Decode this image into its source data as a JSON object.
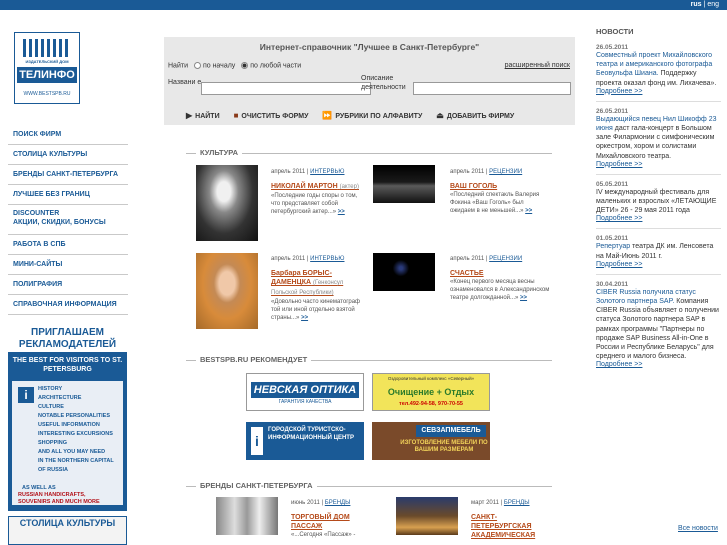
{
  "topbar": {
    "lang_active": "rus",
    "lang_sep": "|",
    "lang_other": "eng"
  },
  "logo": {
    "line1": "ИЗДАТЕЛЬСКИЙ ДОМ",
    "line2": "ТЕЛИНФО",
    "line3": "WWW.BESTSPB.RU"
  },
  "leftnav": {
    "items": [
      "ПОИСК ФИРМ",
      "СТОЛИЦА КУЛЬТУРЫ",
      "БРЕНДЫ САНКТ-ПЕТЕРБУРГА",
      "ЛУЧШЕЕ БЕЗ ГРАНИЦ",
      "DISCOUNTER",
      "РАБОТА В СПБ",
      "МИНИ-САЙТЫ",
      "ПОЛИГРАФИЯ",
      "СПРАВОЧНАЯ ИНФОРМАЦИЯ"
    ],
    "discounter_sub": "АКЦИИ, СКИДКИ, БОНУСЫ"
  },
  "ad_left": {
    "heading": "ПРИГЛАШАЕМ РЕКЛАМОДАТЕЛЕЙ",
    "sub": "THE BEST FOR VISITORS TO ST. PETERSBURG",
    "list": [
      "HISTORY",
      "ARCHITECTURE",
      "CULTURE",
      "NOTABLE PERSONALITIES",
      "USEFUL INFORMATION",
      "INTERESTING EXCURSIONS",
      "SHOPPING",
      "AND ALL YOU MAY NEED",
      "IN THE NORTHERN CAPITAL",
      "OF RUSSIA"
    ],
    "as_well": "AS WELL AS",
    "red": [
      "RUSSIAN HANDICRAFTS,",
      "SOUVENIRS AND MUCH MORE"
    ]
  },
  "ad_left2": {
    "title": "СТОЛИЦА КУЛЬТУРЫ"
  },
  "search": {
    "title": "Интернет-справочник \"Лучшее в Санкт-Петербурге\"",
    "find_label": "Найти",
    "opt1": "по началу",
    "opt2": "по любой части",
    "advanced": "расширенный поиск",
    "name_label": "Названи е",
    "desc_label": "Описание деятельности",
    "btn_find": "НАЙТИ",
    "btn_clear": "ОЧИСТИТЬ ФОРМУ",
    "btn_rubrics": "РУБРИКИ ПО АЛФАВИТУ",
    "btn_add": "ДОБАВИТЬ ФИРМУ"
  },
  "sections": {
    "culture": "КУЛЬТУРА",
    "recommends": "BESTSPB.RU РЕКОМЕНДУЕТ",
    "brands": "БРЕНДЫ САНКТ-ПЕТЕРБУРГА"
  },
  "cards": [
    {
      "date": "апрель 2011 |",
      "tag": "ИНТЕРВЬЮ",
      "name": "НИКОЛАЙ МАРТОН",
      "extra": "(актер)",
      "text": "«Последние годы споры о том, что представляет собой петербургский актер...»",
      "more": ">>"
    },
    {
      "date": "апрель 2011 |",
      "tag": "РЕЦЕНЗИИ",
      "name": "ВАШ ГОГОЛЬ",
      "extra": "",
      "text": "«Последний спектакль Валерия Фокина «Ваш Гоголь» был ожидаем в не меньшей...»",
      "more": ">>"
    },
    {
      "date": "апрель 2011 |",
      "tag": "ИНТЕРВЬЮ",
      "name": "Барбара БОРЫС-ДАМЕНЦКА",
      "extra": "(Генконсул Польской Республики)",
      "text": "«Довольно часто кинематограф той или иной отдельно взятой страны...»",
      "more": ">>"
    },
    {
      "date": "апрель 2011 |",
      "tag": "РЕЦЕНЗИИ",
      "name": "СЧАСТЬЕ",
      "extra": "",
      "text": "«Конец первого месяца весны ознаменовался в Александринском театре долгожданной...»",
      "more": ">>"
    },
    {
      "date": "июнь 2011 |",
      "tag": "БРЕНДЫ",
      "name": "ТОРГОВЫЙ ДОМ ПАССАЖ",
      "extra": "",
      "text": "«...Сегодня «Пассаж» -",
      "more": ""
    },
    {
      "date": "март 2011 |",
      "tag": "БРЕНДЫ",
      "name": "САНКТ-ПЕТЕРБУРГСКАЯ АКАДЕМИЧЕСКАЯ",
      "extra": "",
      "text": "",
      "more": ""
    }
  ],
  "banners": {
    "optika": {
      "title": "НЕВСКАЯ ОПТИКА",
      "sub": "ГАРАНТИЯ КАЧЕСТВА"
    },
    "severny": {
      "top": "Оздоровительный комплекс «Северный»",
      "title": "Очищение + Отдых",
      "phone": "тел.492-94-58, 970-70-55"
    },
    "center": {
      "title": "ГОРОДСКОЙ ТУРИСТСКО-ИНФОРМАЦИОННЫЙ ЦЕНТР"
    },
    "sevzap": {
      "title": "СЕВЗАПМЕБЕЛЬ",
      "sub": "ИЗГОТОВЛЕНИЕ МЕБЕЛИ ПО ВАШИМ РАЗМЕРАМ"
    }
  },
  "news": {
    "heading": "НОВОСТИ",
    "items": [
      {
        "date": "26.05.2011",
        "link": "Совместный проект Михайловского театра и американского фотографа Беовульфа Шиана.",
        "rest": " Поддержку проекта оказал фонд им. Лихачева».",
        "more": "Подробнее >>"
      },
      {
        "date": "26.05.2011",
        "link": "Выдающийся певец Нил Шикофф 23 июня",
        "rest": " даст гала-концерт в Большом зале Филармонии с симфоническим оркестром, хором и солистами Михайловского театра.",
        "more": "Подробнее >>"
      },
      {
        "date": "05.05.2011",
        "link": "",
        "rest": "IV международный фестиваль для маленьких и взрослых «ЛЕТАЮЩИЕ ДЕТИ» 26 - 29 мая 2011 года",
        "more": "Подробнее >>"
      },
      {
        "date": "01.05.2011",
        "link": "Репертуар",
        "rest": " театра ДК им. Ленсовета на Май-Июнь 2011 г.",
        "more": "Подробнее >>"
      },
      {
        "date": "30.04.2011",
        "link": "CIBER Russia получила статус Золотого партнера SAP.",
        "rest": " Компания CIBER Russia объявляет о получении статуса Золотого партнера SAP в рамках программы \"Партнеры по продаже SAP Business All-in-One в России и Республике Беларусь\" для среднего и малого бизнеса.",
        "more": "Подробнее >>"
      }
    ],
    "all": "Все новости"
  }
}
